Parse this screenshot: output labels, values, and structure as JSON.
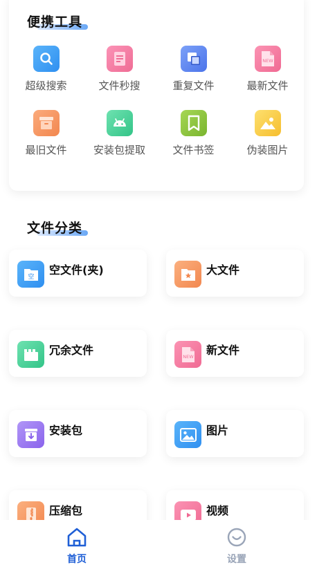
{
  "tools": {
    "title": "便携工具",
    "items": [
      {
        "label": "超级搜索",
        "icon": "search-icon",
        "color": "#3ea2f7"
      },
      {
        "label": "文件秒搜",
        "icon": "document-icon",
        "color": "#f47ba0"
      },
      {
        "label": "重复文件",
        "icon": "copy-icon",
        "color": "#5b86f0"
      },
      {
        "label": "最新文件",
        "icon": "new-file-icon",
        "color": "#f57fa4"
      },
      {
        "label": "最旧文件",
        "icon": "archive-icon",
        "color": "#f59563"
      },
      {
        "label": "安装包提取",
        "icon": "android-icon",
        "color": "#46d39a"
      },
      {
        "label": "文件书签",
        "icon": "bookmark-icon",
        "color": "#8cc43e"
      },
      {
        "label": "伪装图片",
        "icon": "image-icon",
        "color": "#f9c93f"
      }
    ]
  },
  "categories": {
    "title": "文件分类",
    "items": [
      {
        "label": "空文件(夹)",
        "icon": "empty-folder-icon",
        "color": "#3ea2f7",
        "icon_text": "空"
      },
      {
        "label": "大文件",
        "icon": "star-folder-icon",
        "color": "#f59a63"
      },
      {
        "label": "冗余文件",
        "icon": "redundant-file-icon",
        "color": "#46d39a"
      },
      {
        "label": "新文件",
        "icon": "new-file-icon",
        "color": "#f57fa4",
        "icon_text": "NEW"
      },
      {
        "label": "安装包",
        "icon": "package-icon",
        "color": "#9d7cf0"
      },
      {
        "label": "图片",
        "icon": "picture-icon",
        "color": "#3ea2f7"
      },
      {
        "label": "压缩包",
        "icon": "zip-icon",
        "color": "#f59a63"
      },
      {
        "label": "视频",
        "icon": "video-icon",
        "color": "#f57fa4"
      }
    ]
  },
  "nav": {
    "home": {
      "label": "首页",
      "color": "#1f5fd6"
    },
    "settings": {
      "label": "设置",
      "color": "#9aa5b8"
    }
  },
  "new_badge": "NEW"
}
